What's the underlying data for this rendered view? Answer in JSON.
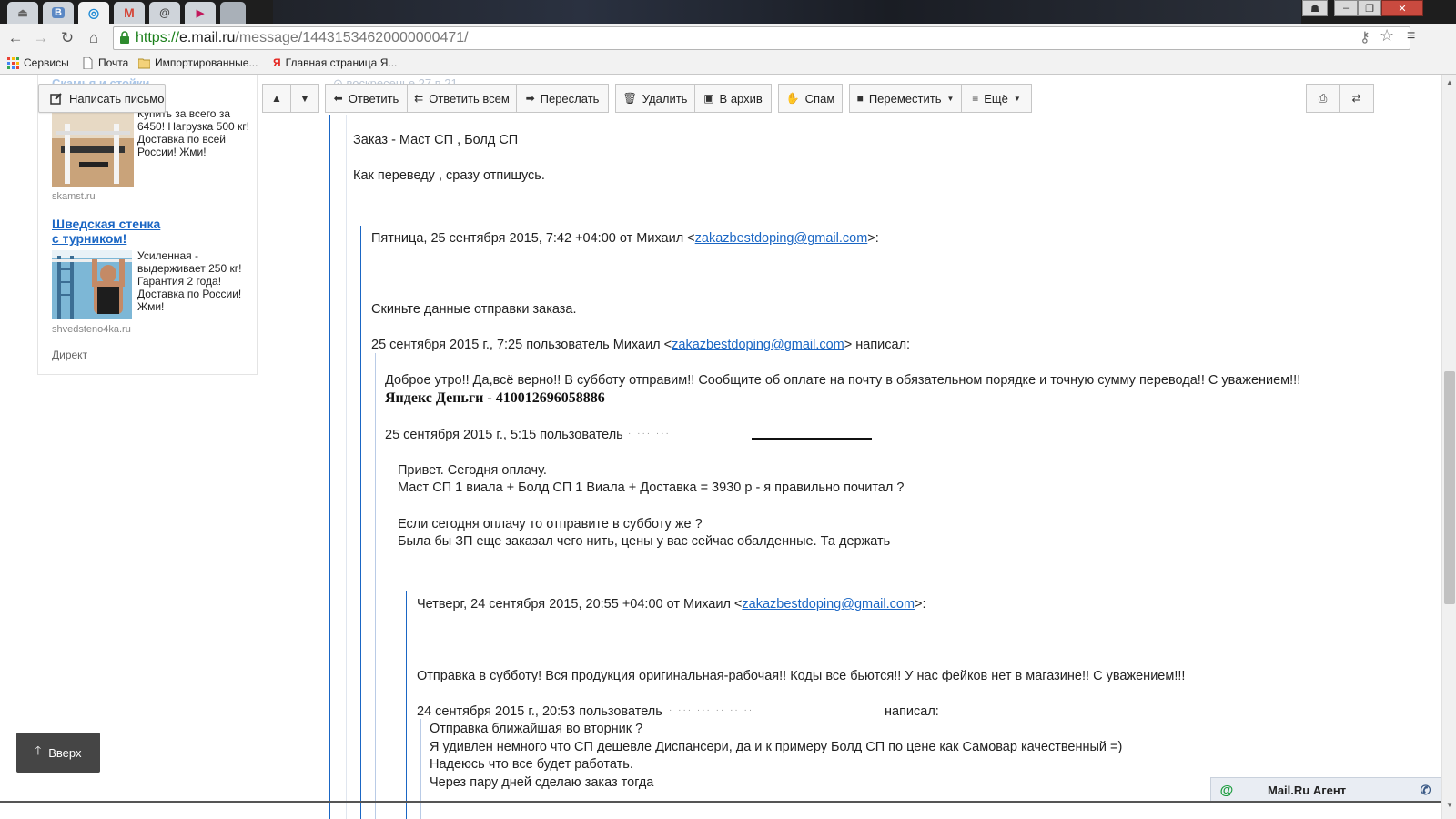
{
  "browser": {
    "tabs": [
      {
        "icon": "scanner-icon",
        "glyph": "⏏"
      },
      {
        "icon": "vk-icon",
        "glyph": "В"
      },
      {
        "icon": "mailru-icon",
        "glyph": "◎"
      },
      {
        "icon": "gmail-icon",
        "glyph": "M"
      },
      {
        "icon": "at-icon",
        "glyph": "@"
      },
      {
        "icon": "play-icon",
        "glyph": "▶"
      }
    ],
    "url_proto": "https://",
    "url_host": "e.mail.ru",
    "url_path": "/message/14431534620000000471/",
    "bookmarks": {
      "services": "Сервисы",
      "mail": "Почта",
      "imported": "Импортированные...",
      "yandex": "Главная страница Я..."
    }
  },
  "sidebar": {
    "compose_label": "Написать письмо",
    "ad1": {
      "faded_title": "Скамья и стойки",
      "text": "Купить за всего за 6450! Нагрузка 500 кг! Доставка по всей России! Жми!",
      "domain": "skamst.ru"
    },
    "ad2": {
      "title_line1": "Шведская стенка",
      "title_line2": "с турником!",
      "text": "Усиленная - выдерживает 250 кг! Гарантия 2 года! Доставка по России! Жми!",
      "domain": "shvedsteno4ka.ru"
    },
    "direkt": "Директ",
    "up_label": "Вверх"
  },
  "mailbar": {
    "reply": "Ответить",
    "reply_all": "Ответить всем",
    "forward": "Переслать",
    "delete": "Удалить",
    "archive": "В архив",
    "spam": "Спам",
    "move": "Переместить",
    "more": "Ещё"
  },
  "message": {
    "faded_date": "⊙ воскресенье 27 в 21",
    "order": "Заказ - Маст СП , Болд СП",
    "will_report": "Как переведу , сразу отпишусь.",
    "q1_header_pre": "Пятница, 25 сентября 2015, 7:42 +04:00 от Михаил <",
    "email": "zakazbestdoping@gmail.com",
    "q1_header_post": ">:",
    "q1_body": "Скиньте данные отправки заказа.",
    "q1_wrote_pre": "25 сентября 2015 г., 7:25 пользователь Михаил <",
    "q1_wrote_post": "> написал:",
    "q2_body": "Доброе утро!! Да,всё верно!! В субботу отправим!! Сообщите об оплате на почту в обязательном порядке и точную сумму перевода!! С уважением!!!",
    "yandex_money": "Яндекс Деньги - 410012696058886",
    "q2_wrote": "25 сентября 2015 г., 5:15 пользователь",
    "q3_line1": "Привет. Сегодня оплачу.",
    "q3_line2": "Маст СП 1 виала + Болд СП 1 Виала + Доставка = 3930 р   - я правильно почитал ?",
    "q3_line3": "Если сегодня оплачу то отправите в субботу же ?",
    "q3_line4": "Была бы ЗП еще заказал чего нить, цены у вас сейчас обалденные. Та держать",
    "q4_header_pre": "Четверг, 24 сентября 2015, 20:55 +04:00 от Михаил <",
    "q4_header_post": ">:",
    "q4_body": "Отправка в субботу! Вся продукция оригинальная-рабочая!! Коды все бьются!! У нас фейков нет в магазине!! С уважением!!!",
    "q4_wrote_pre": "24 сентября 2015 г., 20:53 пользователь",
    "q4_wrote_post": "написал:",
    "q5_line1": "Отправка ближайшая во вторник ?",
    "q5_line2": " Я удивлен немного что СП дешевле  Диспансери, да и к примеру Болд СП по цене как Самовар качественный =)",
    "q5_line3": "Надеюсь что все будет работать.",
    "q5_line4": "Через пару дней сделаю заказ тогда"
  },
  "agent": {
    "label": "Mail.Ru Агент"
  },
  "colors": {
    "link": "#1a66c4",
    "quote_line": "#1a66c4"
  }
}
